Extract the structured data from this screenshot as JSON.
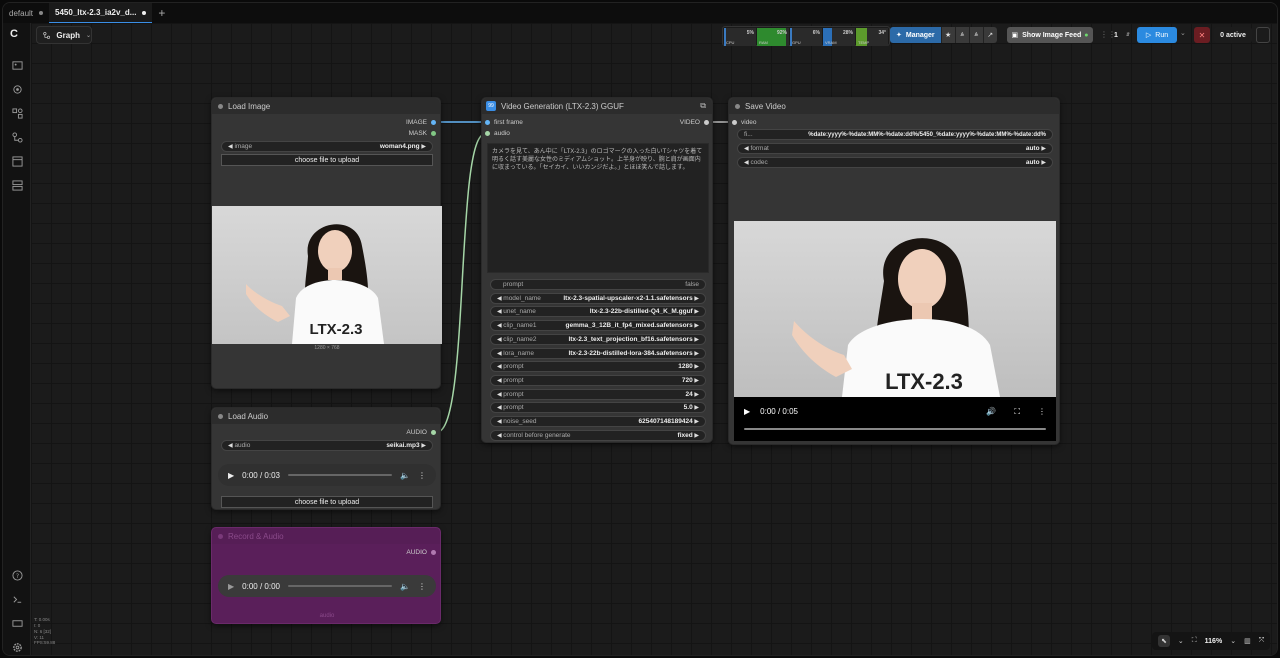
{
  "tabs": [
    {
      "label": "default"
    },
    {
      "label": "5450_ltx-2.3_ia2v_d..."
    }
  ],
  "toolbar": {
    "graph_label": "Graph",
    "monitors": [
      {
        "label": "CPU",
        "value": "5%",
        "level": 0.05,
        "color": "#3a7ac0"
      },
      {
        "label": "RAM",
        "value": "92%",
        "level": 0.92,
        "color": "#2e8a2e"
      },
      {
        "label": "GPU",
        "value": "6%",
        "level": 0.06,
        "color": "#3a7ac0"
      },
      {
        "label": "VRAM",
        "value": "28%",
        "level": 0.28,
        "color": "#2b6fb8"
      },
      {
        "label": "TEMP",
        "value": "34°",
        "level": 0.34,
        "color": "#5c9a2c"
      }
    ],
    "manager_label": "Manager",
    "feed_label": "Show Image Feed",
    "queue_count": "1",
    "run_label": "Run",
    "active_label": "0 active"
  },
  "nodes": {
    "load_image": {
      "title": "Load Image",
      "outputs": [
        "IMAGE",
        "MASK"
      ],
      "image_widget_label": "image",
      "image_widget_value": "woman4.png",
      "upload_label": "choose file to upload",
      "dims": "1280 × 768"
    },
    "load_audio": {
      "title": "Load Audio",
      "output": "AUDIO",
      "audio_widget_label": "audio",
      "audio_widget_value": "seikai.mp3",
      "player_time": "0:00 / 0:03",
      "upload_label": "choose file to upload"
    },
    "preview_audio": {
      "title": "Record & Audio",
      "output": "AUDIO",
      "player_time": "0:00 / 0:00",
      "footer": "audio"
    },
    "video_gen": {
      "title": "Video Generation (LTX-2.3) GGUF",
      "inputs": [
        "first frame",
        "audio"
      ],
      "output": "VIDEO",
      "prompt_text": "カメラを見て、あん中に「LTX-2.3」のロゴマークの入った白いTシャツを着て明るく話す美麗な女性のミディアムショット。上半身が映り、腕と肩が画面内に収まっている。「セイカイ、いいカンジだよ。」とほほ笑んで話します。",
      "widgets": [
        {
          "label": "prompt",
          "value": "false"
        },
        {
          "label": "model_name",
          "value": "ltx-2.3-spatial-upscaler-x2-1.1.safetensors"
        },
        {
          "label": "unet_name",
          "value": "ltx-2.3-22b-distilled-Q4_K_M.gguf"
        },
        {
          "label": "clip_name1",
          "value": "gemma_3_12B_it_fp4_mixed.safetensors"
        },
        {
          "label": "clip_name2",
          "value": "ltx-2.3_text_projection_bf16.safetensors"
        },
        {
          "label": "lora_name",
          "value": "ltx-2.3-22b-distilled-lora-384.safetensors"
        },
        {
          "label": "prompt",
          "value": "1280"
        },
        {
          "label": "prompt",
          "value": "720"
        },
        {
          "label": "prompt",
          "value": "24"
        },
        {
          "label": "prompt",
          "value": "5.0"
        },
        {
          "label": "noise_seed",
          "value": "625407148189424"
        },
        {
          "label": "control before generate",
          "value": "fixed"
        }
      ]
    },
    "save_video": {
      "title": "Save Video",
      "input": "video",
      "widgets": [
        {
          "label": "fi...",
          "value": "%date:yyyy%-%date:MM%-%date:dd%/5450_%date:yyyy%-%date:MM%-%date:dd%"
        },
        {
          "label": "format",
          "value": "auto"
        },
        {
          "label": "codec",
          "value": "auto"
        }
      ],
      "player_time": "0:00 / 0:05"
    }
  },
  "bottom": {
    "zoom": "116%"
  },
  "stats": [
    "T: 0.00s",
    "I: 0",
    "N: 6 [32]",
    "V: 11",
    "FPS:59.88"
  ],
  "shirt_text": "LTX-2.3"
}
